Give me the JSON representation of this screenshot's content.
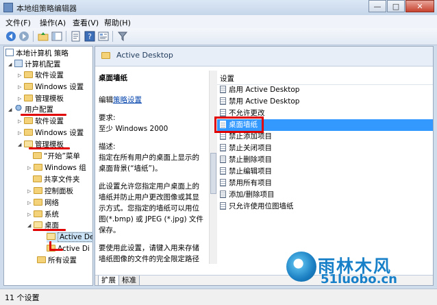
{
  "window": {
    "title": "本地组策略编辑器",
    "min_label": "—",
    "max_label": "□",
    "close_label": "✕"
  },
  "menubar": {
    "items": [
      {
        "label": "文件(F)"
      },
      {
        "label": "操作(A)"
      },
      {
        "label": "查看(V)"
      },
      {
        "label": "帮助(H)"
      }
    ]
  },
  "tree": {
    "items": [
      {
        "label": "本地计算机 策略",
        "icon": "document-icon",
        "expanded": true
      },
      {
        "label": "计算机配置",
        "icon": "computer-icon",
        "expanded": true
      },
      {
        "label": "软件设置",
        "icon": "folder-icon",
        "expanded": false
      },
      {
        "label": "Windows 设置",
        "icon": "folder-icon",
        "expanded": false
      },
      {
        "label": "管理模板",
        "icon": "folder-icon",
        "expanded": false
      },
      {
        "label": "用户配置",
        "icon": "user-icon",
        "expanded": true
      },
      {
        "label": "软件设置",
        "icon": "folder-icon",
        "expanded": false
      },
      {
        "label": "Windows 设置",
        "icon": "folder-icon",
        "expanded": false
      },
      {
        "label": "管理模板",
        "icon": "folder-icon",
        "expanded": true
      },
      {
        "label": "“开始”菜单",
        "icon": "folder-icon"
      },
      {
        "label": "Windows 组",
        "icon": "folder-icon"
      },
      {
        "label": "共享文件夹",
        "icon": "folder-icon"
      },
      {
        "label": "控制面板",
        "icon": "folder-icon"
      },
      {
        "label": "网络",
        "icon": "folder-icon"
      },
      {
        "label": "系统",
        "icon": "folder-icon"
      },
      {
        "label": "桌面",
        "icon": "folder-icon",
        "expanded": true
      },
      {
        "label": "Active De",
        "icon": "folder-icon",
        "selected": true
      },
      {
        "label": "Active Di",
        "icon": "folder-icon"
      },
      {
        "label": "所有设置",
        "icon": "folder-icon"
      }
    ]
  },
  "right": {
    "header_title": "Active Desktop",
    "desc": {
      "title": "桌面墙纸",
      "edit_prefix": "编辑",
      "edit_link": "策略设置",
      "req_label": "要求:",
      "req_value": "至少 Windows 2000",
      "desc_label": "描述:",
      "desc_text": "指定在所有用户的桌面上显示的桌面背景(“墙纸”)。",
      "desc_text2": "此设置允许您指定用户桌面上的墙纸并防止用户更改图像或其显示方式。您指定的墙纸可以用位图(*.bmp) 或 JPEG (*.jpg) 文件保存。",
      "desc_text3": "要使用此设置，请键入用来存储墙纸图像的文件的完全限定路径和名"
    },
    "list_header": "设置",
    "settings": [
      {
        "label": "启用 Active Desktop"
      },
      {
        "label": "禁用 Active Desktop"
      },
      {
        "label": "不允许更改"
      },
      {
        "label": "桌面墙纸",
        "selected": true
      },
      {
        "label": "禁止添加项目"
      },
      {
        "label": "禁止关闭项目"
      },
      {
        "label": "禁止删除项目"
      },
      {
        "label": "禁止编辑项目"
      },
      {
        "label": "禁用所有项目"
      },
      {
        "label": "添加/删除项目"
      },
      {
        "label": "只允许使用位图墙纸"
      }
    ],
    "tabs": [
      {
        "label": "扩展"
      },
      {
        "label": "标准"
      }
    ]
  },
  "status": {
    "text": "11 个设置"
  },
  "watermark": {
    "top": "雨林木风",
    "bottom": "51luobo.cn"
  },
  "colors": {
    "annotation_red": "#e00000",
    "selection_blue": "#3399ff",
    "watermark_blue": "#1780c8"
  }
}
